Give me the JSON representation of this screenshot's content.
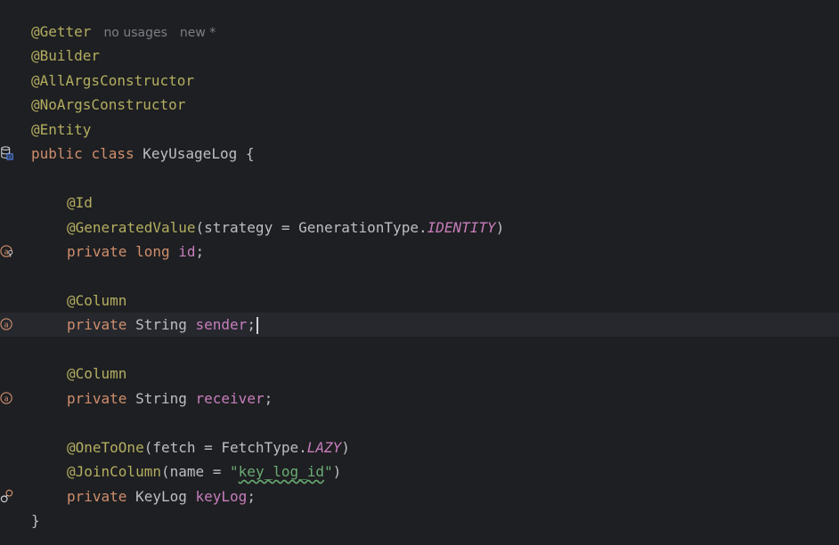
{
  "hints": {
    "usages": "no usages",
    "new": "new *"
  },
  "code": {
    "ann_getter": "@Getter",
    "ann_builder": "@Builder",
    "ann_allargs": "@AllArgsConstructor",
    "ann_noargs": "@NoArgsConstructor",
    "ann_entity": "@Entity",
    "kw_public": "public",
    "kw_class": "class",
    "class_name": "KeyUsageLog",
    "open_brace": "{",
    "ann_id": "@Id",
    "ann_generated": "@GeneratedValue",
    "generated_args_pre": "(strategy = GenerationType.",
    "identity": "IDENTITY",
    "close_paren": ")",
    "kw_private": "private",
    "kw_long": "long",
    "field_id": "id",
    "semicolon": ";",
    "ann_column": "@Column",
    "type_string": "String",
    "field_sender": "sender",
    "field_receiver": "receiver",
    "ann_onetoone": "@OneToOne",
    "onetoone_args_pre": "(fetch = FetchType.",
    "lazy": "LAZY",
    "ann_joincolumn": "@JoinColumn",
    "joincolumn_args_pre": "(name = ",
    "quote": "\"",
    "join_value": "key_log_id",
    "type_keylog": "KeyLog",
    "field_keylog": "keyLog",
    "close_brace": "}"
  },
  "gutter_icons": [
    "database-entity-icon",
    "id-field-icon",
    "field-attribute-icon",
    "field-attribute-icon",
    "relation-icon"
  ],
  "colors": {
    "background": "#1e1f22",
    "annotation": "#b3ae60",
    "keyword": "#cf8e6d",
    "field": "#c77dbb",
    "string": "#6aab73",
    "text": "#bcbec4",
    "hint": "#7a7e85",
    "gutter_icon": "#cf8e6d"
  }
}
